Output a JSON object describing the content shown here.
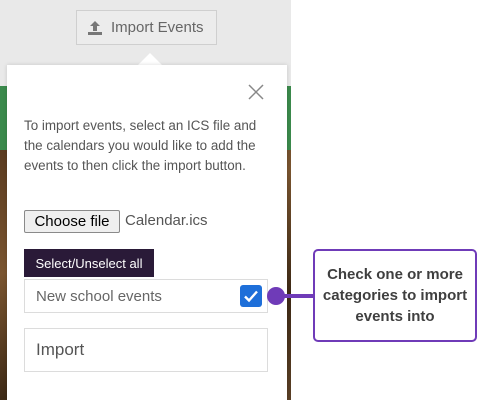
{
  "toolbar": {
    "import_events_label": "Import Events"
  },
  "popup": {
    "instructions": "To import events, select an ICS file and the calendars you would like to add the events to then click the import button.",
    "choose_file_label": "Choose file",
    "file_name": "Calendar.ics",
    "select_all_label": "Select/Unselect all",
    "categories": [
      {
        "label": "New school events",
        "checked": true
      }
    ],
    "import_label": "Import"
  },
  "callout": {
    "text": "Check one or more categories to import events into"
  },
  "colors": {
    "accent_purple": "#6f3bb8",
    "dark_purple": "#2a1a38",
    "checkbox_blue": "#1e6fd9",
    "green_bar": "#3b8a4c"
  },
  "icons": {
    "upload": "upload-icon",
    "close": "close-icon",
    "check": "checkmark-icon"
  }
}
